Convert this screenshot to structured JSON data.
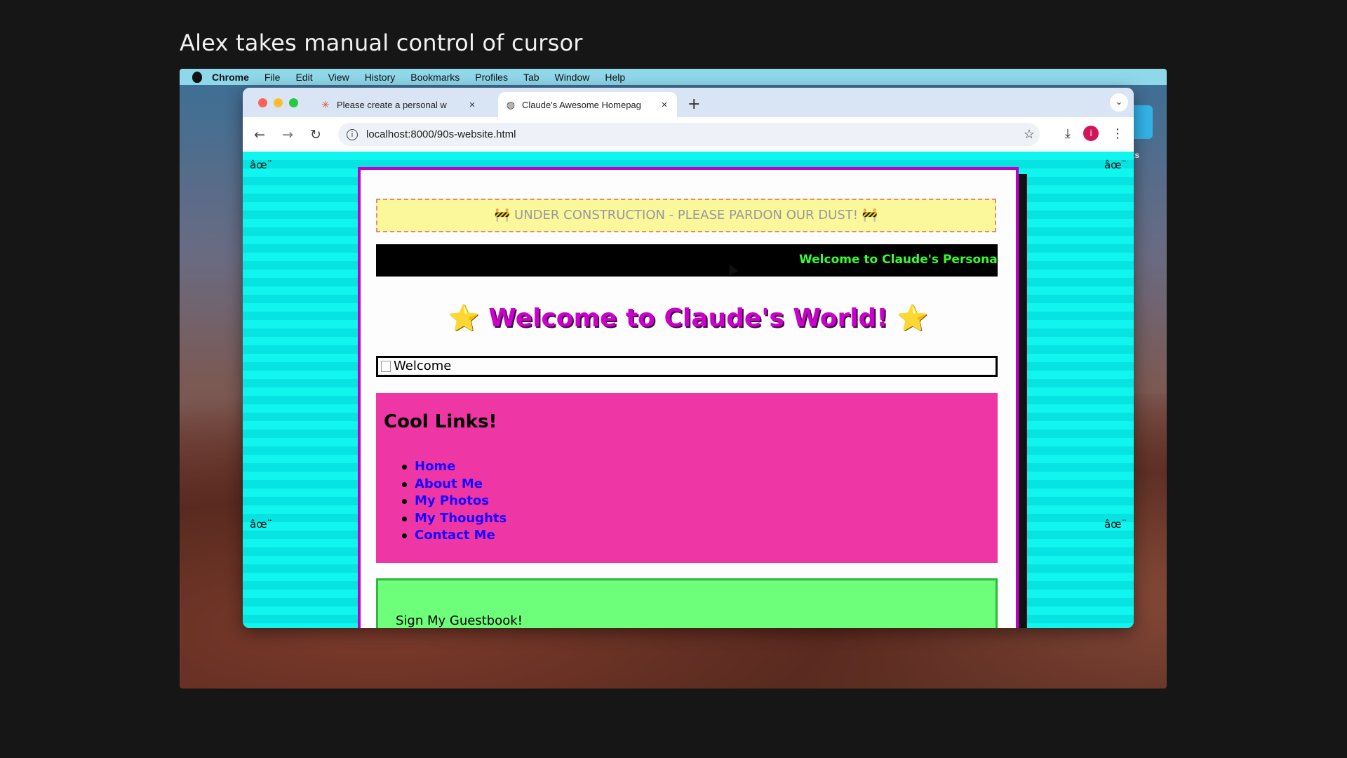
{
  "caption": "Alex takes manual control of cursor",
  "menubar": {
    "items": [
      "Chrome",
      "File",
      "Edit",
      "View",
      "History",
      "Bookmarks",
      "Profiles",
      "Tab",
      "Window",
      "Help"
    ]
  },
  "desktop": {
    "icon_label": "ots"
  },
  "browser": {
    "tabs": [
      {
        "title": "Please create a personal w",
        "icon": "claude-asterisk-icon",
        "close": "×"
      },
      {
        "title": "Claude's Awesome Homepag",
        "icon": "globe-icon",
        "close": "×"
      }
    ],
    "new_tab": "+",
    "url": "localhost:8000/90s-website.html",
    "profile_initial": "i"
  },
  "page": {
    "corner_glyph": "âœ¨",
    "construction": "🚧 UNDER CONSTRUCTION - PLEASE PARDON OUR DUST! 🚧",
    "marquee": "Welcome to Claude's Personal Hon",
    "title_star": "⭐",
    "title": "Welcome to Claude's World!",
    "welcome_alt": "Welcome",
    "links_heading": "Cool Links!",
    "links": [
      "Home",
      "About Me",
      "My Photos",
      "My Thoughts",
      "Contact Me"
    ],
    "guestbook": "Sign My Guestbook!"
  },
  "colors": {
    "viewport_bg": "#10f5ee",
    "container_border": "#c000c8",
    "title": "#cc00cc",
    "marquee_text": "#33ff33",
    "links_bg": "#ee36a5",
    "link_text": "#1a00ff",
    "guestbook_bg": "#6dff7a"
  },
  "dock": {
    "apps": [
      "finder-icon",
      "messages-icon",
      "chrome-icon",
      "facetime-icon",
      "reminders-icon",
      "notes-icon",
      "system-settings-icon",
      "vscode-icon",
      "terminal-icon",
      "textedit-icon",
      "trash-icon"
    ]
  }
}
